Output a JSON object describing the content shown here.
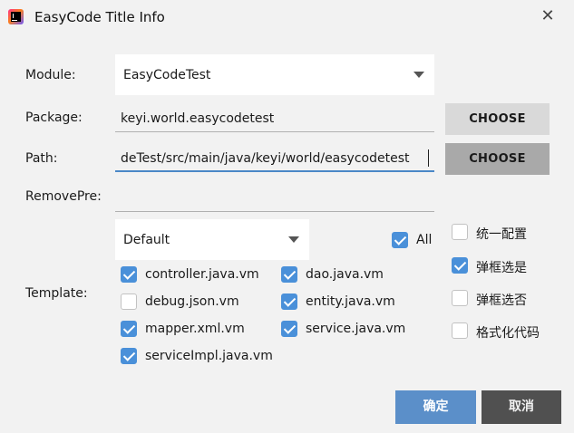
{
  "window": {
    "title": "EasyCode Title Info",
    "close": "✕"
  },
  "labels": {
    "module": "Module:",
    "package": "Package:",
    "path": "Path:",
    "remove_pre": "RemovePre:",
    "template": "Template:"
  },
  "module_combo": {
    "value": "EasyCodeTest"
  },
  "package_field": {
    "value": "keyi.world.easycodetest"
  },
  "path_field": {
    "value": "deTest/src/main/java/keyi/world/easycodetest"
  },
  "remove_pre_field": {
    "value": ""
  },
  "choose_buttons": {
    "package": "CHOOSE",
    "path": "CHOOSE"
  },
  "template_combo": {
    "value": "Default"
  },
  "all_checkbox": {
    "label": "All",
    "checked": true
  },
  "templates": [
    {
      "label": "controller.java.vm",
      "checked": true
    },
    {
      "label": "dao.java.vm",
      "checked": true
    },
    {
      "label": "debug.json.vm",
      "checked": false
    },
    {
      "label": "entity.java.vm",
      "checked": true
    },
    {
      "label": "mapper.xml.vm",
      "checked": true
    },
    {
      "label": "service.java.vm",
      "checked": true
    },
    {
      "label": "serviceImpl.java.vm",
      "checked": true
    }
  ],
  "options": [
    {
      "label": "统一配置",
      "checked": false
    },
    {
      "label": "弹框选是",
      "checked": true
    },
    {
      "label": "弹框选否",
      "checked": false
    },
    {
      "label": "格式化代码",
      "checked": false
    }
  ],
  "footer": {
    "ok": "确定",
    "cancel": "取消"
  },
  "colors": {
    "accent": "#4a90d9",
    "ok_button": "#5b8fc9",
    "cancel_button": "#505050"
  }
}
